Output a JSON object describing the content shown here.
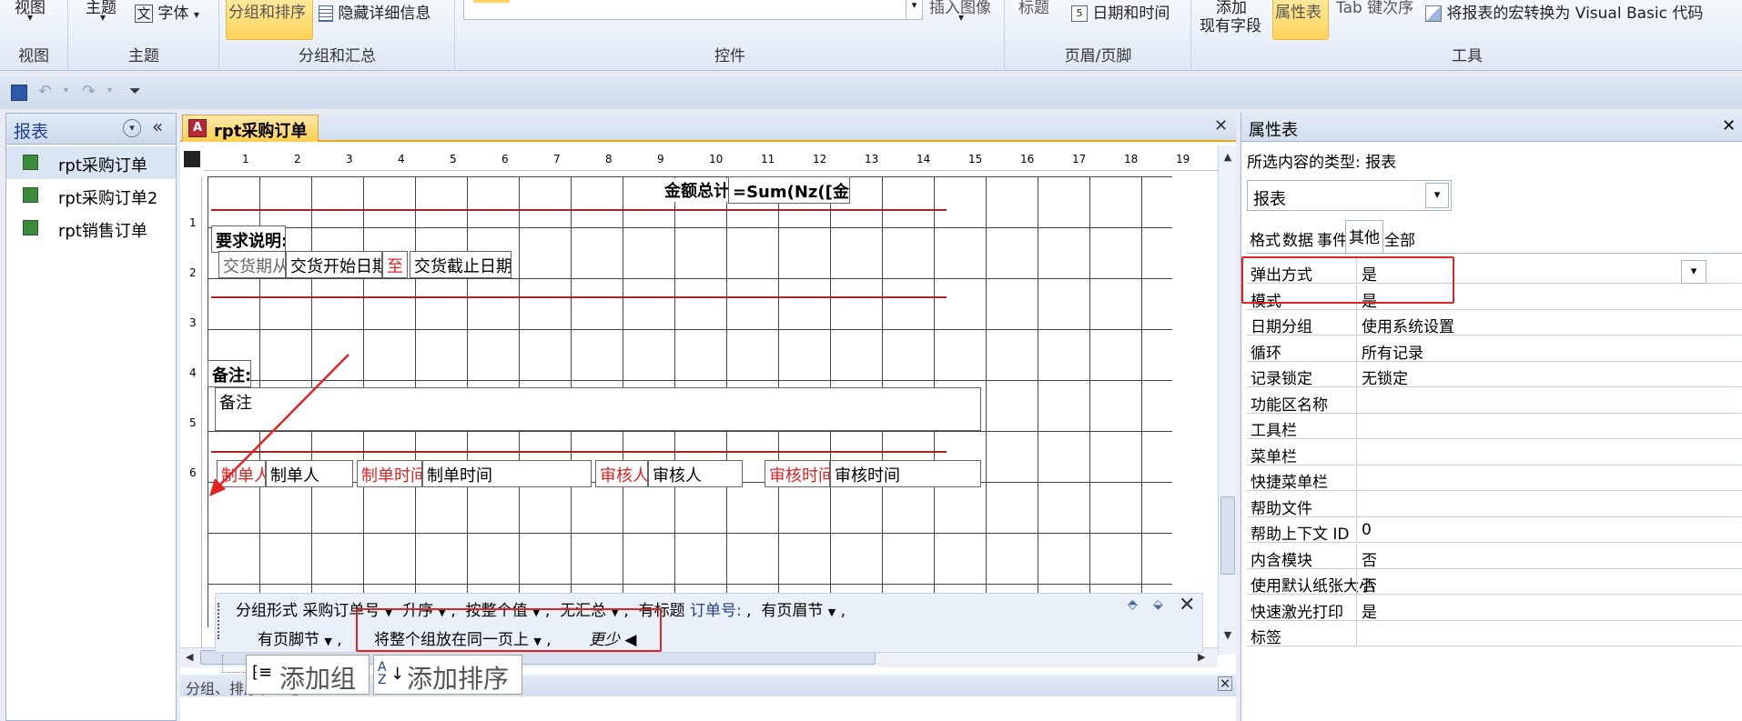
{
  "ribbon": {
    "view_group": {
      "label_top": "视图",
      "group_name": "视图"
    },
    "theme_group": {
      "theme_label": "主题",
      "font_label": "字体",
      "group_name": "主题"
    },
    "grouping_group": {
      "group_sort_label": "分组和排序",
      "hide_details_label": "隐藏详细信息",
      "group_name": "分组和汇总"
    },
    "controls_group": {
      "insert_image_label": "插入图像",
      "group_name": "控件"
    },
    "header_footer_group": {
      "title_label": "标题",
      "date_time_label": "日期和时间",
      "group_name": "页眉/页脚"
    },
    "tools_group": {
      "add_existing_fields_top": "添加",
      "add_existing_fields_label": "现有字段",
      "property_sheet_label": "属性表",
      "tab_order_label": "Tab 键次序",
      "convert_macros_label": "将报表的宏转换为 Visual Basic 代码",
      "group_name": "工具"
    }
  },
  "nav": {
    "title": "报表",
    "items": [
      {
        "label": "rpt采购订单"
      },
      {
        "label": "rpt采购订单2"
      },
      {
        "label": "rpt销售订单"
      }
    ]
  },
  "document": {
    "tab_label": "rpt采购订单",
    "ruler_numbers": [
      "1",
      "2",
      "3",
      "4",
      "5",
      "6",
      "7",
      "8",
      "9",
      "10",
      "11",
      "12",
      "13",
      "14",
      "15",
      "16",
      "17",
      "18",
      "19"
    ],
    "vruler_numbers": [
      "1",
      "2",
      "3",
      "4",
      "5",
      "6"
    ],
    "controls": {
      "total_label": "金额总计:",
      "total_expr": "=Sum(Nz([金额]))",
      "requirements_label": "要求说明:",
      "delivery_period": "交货期从",
      "delivery_start": "交货开始日期",
      "to_label": "至",
      "delivery_end": "交货截止日期",
      "remarks_label": "备注:",
      "remarks_box": "备注",
      "creator_label": "制单人:",
      "creator_field": "制单人",
      "create_time_label": "制单时间:",
      "create_time_field": "制单时间",
      "reviewer_label": "审核人:",
      "reviewer_field": "审核人",
      "review_time_label": "审核时间:",
      "review_time_field": "审核时间"
    }
  },
  "group_pane": {
    "title": "分组、排序和汇总",
    "group_by_prefix": "分组形式",
    "group_field": "采购订单号",
    "sort_order": "升序",
    "by_value": "按整个值",
    "totals": "无汇总",
    "title_prefix": "有标题",
    "title_value": "订单号:",
    "header_section": "有页眉节",
    "footer_section": "有页脚节",
    "keep_together": "将整个组放在同一页上",
    "less_label": "更少 ◀",
    "add_group_label": "添加组",
    "add_sort_label": "添加排序"
  },
  "property_sheet": {
    "title": "属性表",
    "selection_type_label": "所选内容的类型:",
    "selection_type_value": "报表",
    "selector_value": "报表",
    "tabs": [
      "格式",
      "数据",
      "事件",
      "其他",
      "全部"
    ],
    "active_tab": "其他",
    "rows": [
      {
        "key": "弹出方式",
        "value": "是"
      },
      {
        "key": "模式",
        "value": "是"
      },
      {
        "key": "日期分组",
        "value": "使用系统设置"
      },
      {
        "key": "循环",
        "value": "所有记录"
      },
      {
        "key": "记录锁定",
        "value": "无锁定"
      },
      {
        "key": "功能区名称",
        "value": ""
      },
      {
        "key": "工具栏",
        "value": ""
      },
      {
        "key": "菜单栏",
        "value": ""
      },
      {
        "key": "快捷菜单栏",
        "value": ""
      },
      {
        "key": "帮助文件",
        "value": ""
      },
      {
        "key": "帮助上下文 ID",
        "value": "0"
      },
      {
        "key": "内含模块",
        "value": "否"
      },
      {
        "key": "使用默认纸张大小",
        "value": "否"
      },
      {
        "key": "快速激光打印",
        "value": "是"
      },
      {
        "key": "标签",
        "value": ""
      }
    ]
  },
  "colors": {
    "accent_orange": "#f0a41c",
    "highlight_red": "#e02424",
    "label_red": "#e02424",
    "title_blue": "#1f3f8a"
  }
}
